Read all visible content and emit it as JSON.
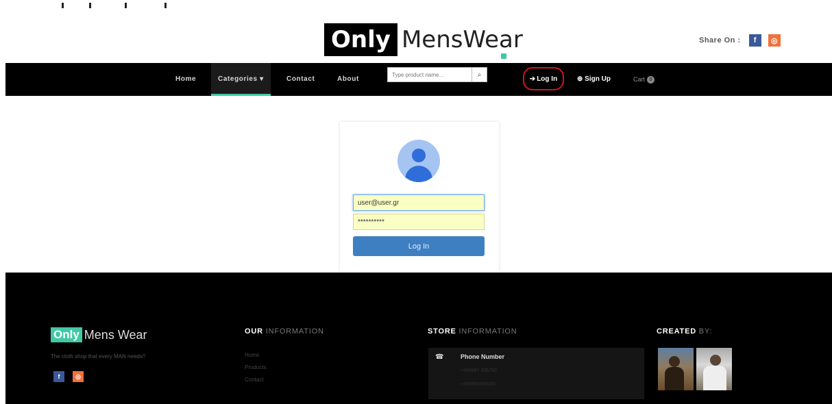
{
  "header": {
    "logo_only": "Only",
    "logo_rest": "MensWear",
    "share_label": "Share On :",
    "share_icons": [
      "facebook-icon",
      "rss-icon"
    ]
  },
  "nav": {
    "home": "Home",
    "categories": "Categories ▾",
    "contact": "Contact",
    "about": "About",
    "search_placeholder": "Type product name...",
    "login": "Log In",
    "signup": "Sign Up",
    "cart": "Cart",
    "cart_count": "0"
  },
  "login_form": {
    "email_value": "user@user.gr",
    "password_value": "**********",
    "submit_label": "Log In"
  },
  "footer": {
    "logo_only": "Only",
    "logo_rest": "Mens Wear",
    "tagline": "The cloth shop that every MAN needs!!",
    "our_info_bold": "OUR",
    "our_info_rest": " INFORMATION",
    "links": [
      "Home",
      "Products",
      "Contact"
    ],
    "store_info_bold": "STORE",
    "store_info_rest": " INFORMATION",
    "phone_label": "Phone Number",
    "phones": [
      "+306987 335750",
      "+306983555000"
    ],
    "created_bold": "CREATED",
    "created_rest": " BY:"
  },
  "colors": {
    "accent": "#3fc9a5",
    "navbar_bg": "#000000",
    "login_button": "#3e7fc1",
    "highlight_circle": "#d1161b"
  }
}
